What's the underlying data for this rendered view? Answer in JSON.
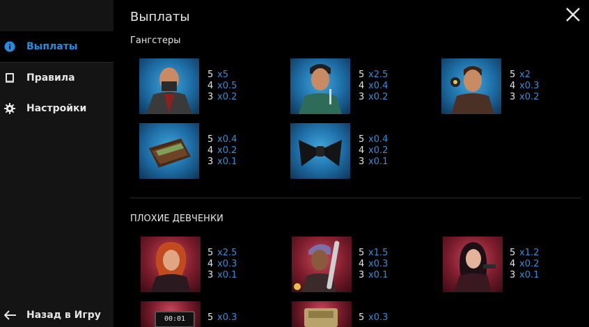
{
  "header": {
    "title": "Выплаты"
  },
  "sidebar": {
    "items": [
      {
        "label": "Выплаты",
        "icon": "info-icon",
        "active": true
      },
      {
        "label": "Правила",
        "icon": "book-icon",
        "active": false
      },
      {
        "label": "Настройки",
        "icon": "gear-icon",
        "active": false
      }
    ],
    "back_label": "Назад в Игру"
  },
  "colors": {
    "accent": "#1e8fe6",
    "value": "#2f8fd6",
    "sidebar_bg": "#141414",
    "bg": "#000000"
  },
  "sections": [
    {
      "title": "Гангстеры",
      "symbols": [
        {
          "icon": "bald-gangster-symbol",
          "pays": [
            {
              "count": "5",
              "mult": "x5"
            },
            {
              "count": "4",
              "mult": "x0.5"
            },
            {
              "count": "3",
              "mult": "x0.2"
            }
          ]
        },
        {
          "icon": "knife-gangster-symbol",
          "pays": [
            {
              "count": "5",
              "mult": "x2.5"
            },
            {
              "count": "4",
              "mult": "x0.4"
            },
            {
              "count": "3",
              "mult": "x0.2"
            }
          ]
        },
        {
          "icon": "chip-gangster-symbol",
          "pays": [
            {
              "count": "5",
              "mult": "x2"
            },
            {
              "count": "4",
              "mult": "x0.3"
            },
            {
              "count": "3",
              "mult": "x0.2"
            }
          ]
        },
        {
          "icon": "wallet-symbol",
          "pays": [
            {
              "count": "5",
              "mult": "x0.4"
            },
            {
              "count": "4",
              "mult": "x0.2"
            },
            {
              "count": "3",
              "mult": "x0.1"
            }
          ]
        },
        {
          "icon": "bowtie-symbol",
          "pays": [
            {
              "count": "5",
              "mult": "x0.4"
            },
            {
              "count": "4",
              "mult": "x0.2"
            },
            {
              "count": "3",
              "mult": "x0.1"
            }
          ]
        }
      ]
    },
    {
      "title": "ПЛОХИЕ ДЕВЧЕНКИ",
      "symbols": [
        {
          "icon": "redhead-girl-symbol",
          "pays": [
            {
              "count": "5",
              "mult": "x2.5"
            },
            {
              "count": "4",
              "mult": "x0.3"
            },
            {
              "count": "3",
              "mult": "x0.1"
            }
          ]
        },
        {
          "icon": "bat-girl-symbol",
          "pays": [
            {
              "count": "5",
              "mult": "x1.5"
            },
            {
              "count": "4",
              "mult": "x0.3"
            },
            {
              "count": "3",
              "mult": "x0.1"
            }
          ]
        },
        {
          "icon": "gun-girl-symbol",
          "pays": [
            {
              "count": "5",
              "mult": "x1.2"
            },
            {
              "count": "4",
              "mult": "x0.2"
            },
            {
              "count": "3",
              "mult": "x0.1"
            }
          ]
        },
        {
          "icon": "timer-symbol",
          "timer_text": "00:01",
          "pays": [
            {
              "count": "5",
              "mult": "x0.3"
            }
          ]
        },
        {
          "icon": "cash-symbol",
          "pays": [
            {
              "count": "5",
              "mult": "x0.3"
            }
          ]
        }
      ]
    }
  ]
}
